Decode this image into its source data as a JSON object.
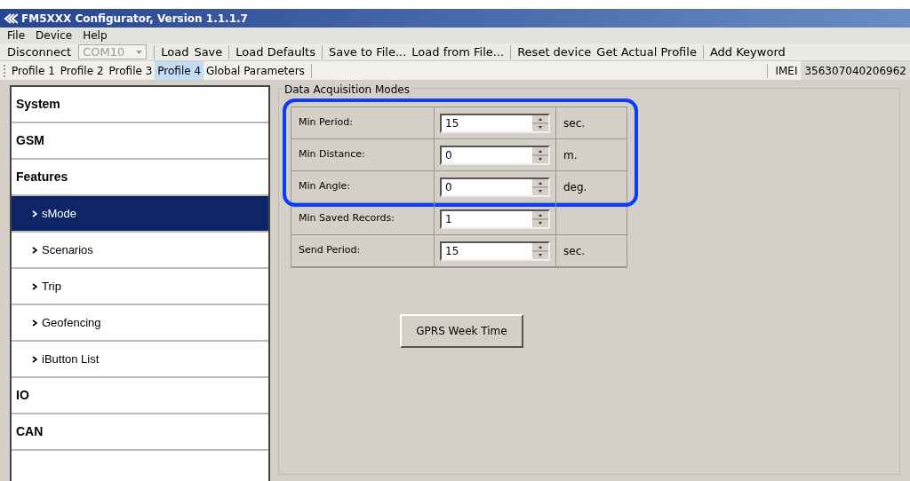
{
  "window": {
    "title": "FM5XXX Configurator, Version 1.1.1.7"
  },
  "menu": [
    "File",
    "Device",
    "Help"
  ],
  "toolbar": {
    "disconnect": "Disconnect",
    "port": {
      "value": "COM10",
      "disabled": true
    },
    "groups": [
      [
        "Load",
        "Save"
      ],
      [
        "Load Defaults"
      ],
      [
        "Save to File...",
        "Load from File..."
      ],
      [
        "Reset device",
        "Get Actual Profile"
      ],
      [
        "Add Keyword"
      ]
    ]
  },
  "profile_tabs": [
    {
      "label": "Profile 1",
      "selected": false
    },
    {
      "label": "Profile 2",
      "selected": false
    },
    {
      "label": "Profile 3",
      "selected": false
    },
    {
      "label": "Profile 4",
      "selected": true
    },
    {
      "label": "Global Parameters",
      "selected": false
    }
  ],
  "imei": {
    "label": "IMEI",
    "value": "356307040206962"
  },
  "sidebar": {
    "items": [
      {
        "label": "System"
      },
      {
        "label": "GSM"
      },
      {
        "label": "Features",
        "children": [
          {
            "label": "sMode",
            "selected": true
          },
          {
            "label": "Scenarios",
            "selected": false
          },
          {
            "label": "Trip",
            "selected": false
          },
          {
            "label": "Geofencing",
            "selected": false
          },
          {
            "label": "iButton List",
            "selected": false
          }
        ]
      },
      {
        "label": "IO"
      },
      {
        "label": "CAN"
      }
    ]
  },
  "group": {
    "title": "Data Acquisition Modes",
    "row_blocks": [
      {
        "highlighted": true,
        "rows": [
          {
            "label": "Min Period:",
            "value": "15",
            "unit": "sec."
          },
          {
            "label": "Min Distance:",
            "value": "0",
            "unit": "m."
          },
          {
            "label": "Min Angle:",
            "value": "0",
            "unit": "deg."
          }
        ]
      },
      {
        "highlighted": false,
        "rows": [
          {
            "label": "Min Saved Records:",
            "value": "1"
          },
          {
            "label": "Send Period:",
            "value": "15",
            "unit": "sec."
          }
        ]
      }
    ],
    "button": "GPRS Week Time"
  }
}
